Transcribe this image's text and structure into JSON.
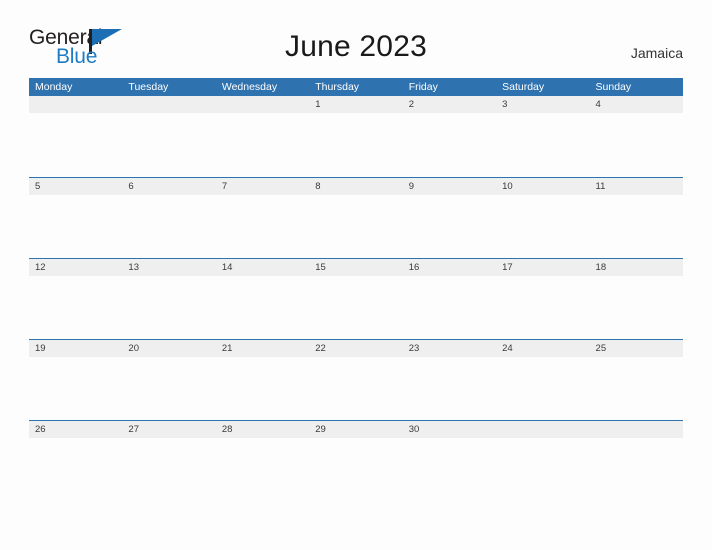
{
  "brand": {
    "name_part1": "General",
    "name_part2": "Blue",
    "flag_icon": "flag-triangle-icon",
    "color_primary": "#1c6fb4",
    "color_text": "#231f20"
  },
  "header": {
    "title": "June 2023",
    "locale": "Jamaica"
  },
  "theme": {
    "header_row_bg": "#2f72b0",
    "date_band_bg": "#efefef",
    "date_band_border": "#2f72b0",
    "page_bg": "#fdfdfd",
    "date_text": "#3a3a3a",
    "weekday_text": "#ffffff"
  },
  "calendar": {
    "month": "June",
    "year": "2023",
    "week_start": "Monday",
    "weekdays": [
      "Monday",
      "Tuesday",
      "Wednesday",
      "Thursday",
      "Friday",
      "Saturday",
      "Sunday"
    ],
    "weeks": [
      [
        "",
        "",
        "",
        "1",
        "2",
        "3",
        "4"
      ],
      [
        "5",
        "6",
        "7",
        "8",
        "9",
        "10",
        "11"
      ],
      [
        "12",
        "13",
        "14",
        "15",
        "16",
        "17",
        "18"
      ],
      [
        "19",
        "20",
        "21",
        "22",
        "23",
        "24",
        "25"
      ],
      [
        "26",
        "27",
        "28",
        "29",
        "30",
        "",
        ""
      ]
    ]
  }
}
